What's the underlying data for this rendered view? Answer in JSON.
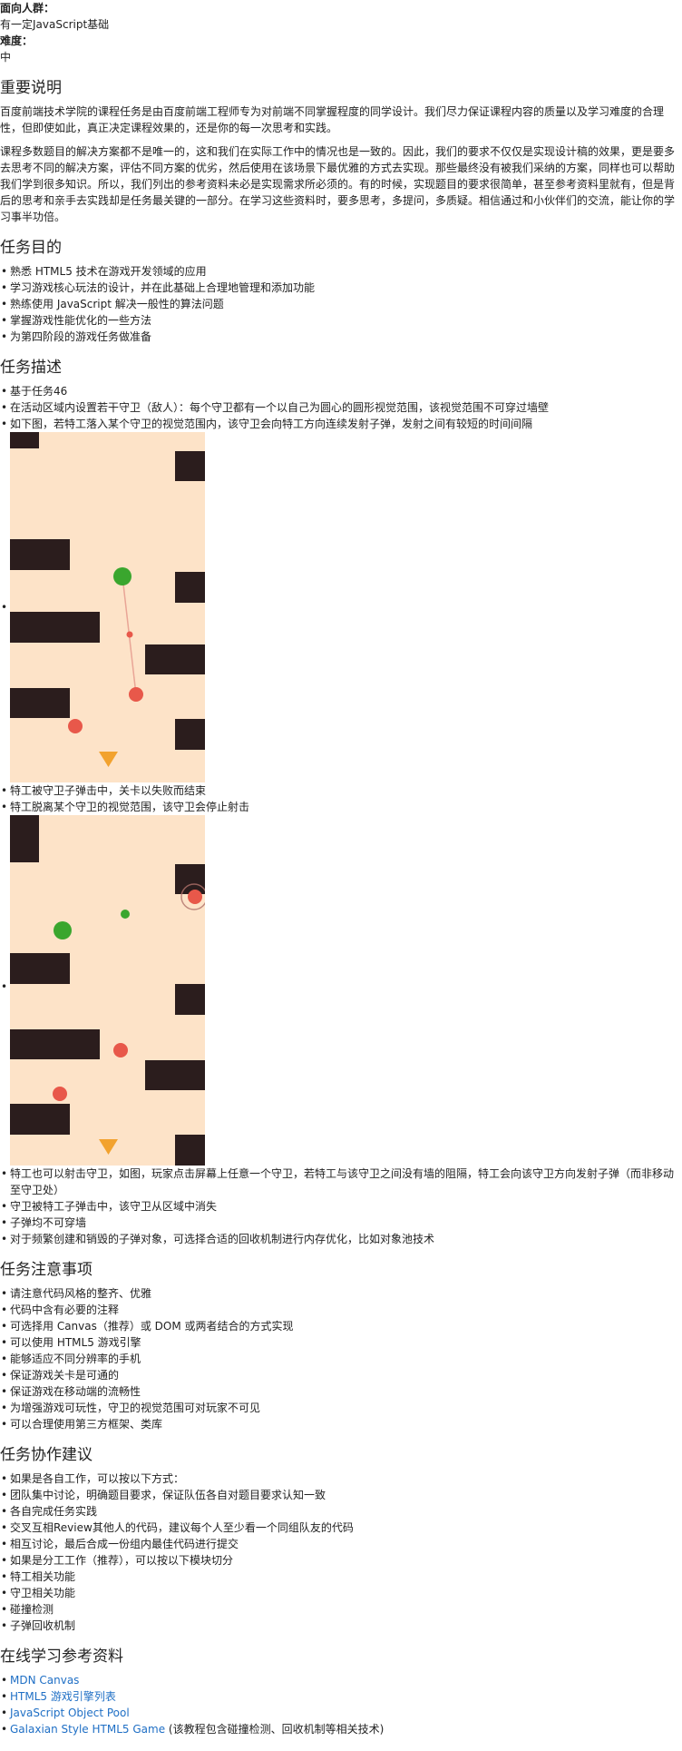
{
  "meta": {
    "audience_label": "面向人群：",
    "audience_value": "有一定JavaScript基础",
    "difficulty_label": "难度：",
    "difficulty_value": "中"
  },
  "notice": {
    "title": "重要说明",
    "paragraphs": [
      "百度前端技术学院的课程任务是由百度前端工程师专为对前端不同掌握程度的同学设计。我们尽力保证课程内容的质量以及学习难度的合理性，但即使如此，真正决定课程效果的，还是你的每一次思考和实践。",
      "课程多数题目的解决方案都不是唯一的，这和我们在实际工作中的情况也是一致的。因此，我们的要求不仅仅是实现设计稿的效果，更是要多去思考不同的解决方案，评估不同方案的优劣，然后使用在该场景下最优雅的方式去实现。那些最终没有被我们采纳的方案，同样也可以帮助我们学到很多知识。所以，我们列出的参考资料未必是实现需求所必须的。有的时候，实现题目的要求很简单，甚至参考资料里就有，但是背后的思考和亲手去实践却是任务最关键的一部分。在学习这些资料时，要多思考，多提问，多质疑。相信通过和小伙伴们的交流，能让你的学习事半功倍。"
    ]
  },
  "purpose": {
    "title": "任务目的",
    "items": [
      "熟悉 HTML5 技术在游戏开发领域的应用",
      "学习游戏核心玩法的设计，并在此基础上合理地管理和添加功能",
      "熟练使用 JavaScript 解决一般性的算法问题",
      "掌握游戏性能优化的一些方法",
      "为第四阶段的游戏任务做准备"
    ]
  },
  "desc": {
    "title": "任务描述",
    "items_a": [
      "基于任务46",
      "在活动区域内设置若干守卫（敌人）：每个守卫都有一个以自己为圆心的圆形视觉范围，该视觉范围不可穿过墙壁",
      "如下图，若特工落入某个守卫的视觉范围内，该守卫会向特工方向连续发射子弹，发射之间有较短的时间间隔"
    ],
    "items_b": [
      "特工被守卫子弹击中，关卡以失败而结束",
      "特工脱离某个守卫的视觉范围，该守卫会停止射击"
    ],
    "items_c": [
      "特工也可以射击守卫，如图，玩家点击屏幕上任意一个守卫，若特工与该守卫之间没有墙的阻隔，特工会向该守卫方向发射子弹（而非移动至守卫处）",
      "守卫被特工子弹击中，该守卫从区域中消失",
      "子弹均不可穿墙",
      "对于频繁创建和销毁的子弹对象，可选择合适的回收机制进行内存优化，比如对象池技术"
    ]
  },
  "notes": {
    "title": "任务注意事项",
    "items": [
      "请注意代码风格的整齐、优雅",
      "代码中含有必要的注释",
      "可选择用 Canvas（推荐）或 DOM 或两者结合的方式实现",
      "可以使用 HTML5 游戏引擎",
      "能够适应不同分辨率的手机",
      "保证游戏关卡是可通的",
      "保证游戏在移动端的流畅性",
      "为增强游戏可玩性，守卫的视觉范围可对玩家不可见",
      "可以合理使用第三方框架、类库"
    ]
  },
  "collab": {
    "title": "任务协作建议",
    "items": [
      "如果是各自工作，可以按以下方式：",
      "团队集中讨论，明确题目要求，保证队伍各自对题目要求认知一致",
      "各自完成任务实践",
      "交叉互相Review其他人的代码，建议每个人至少看一个同组队友的代码",
      "相互讨论，最后合成一份组内最佳代码进行提交",
      "如果是分工工作（推荐），可以按以下模块切分",
      "特工相关功能",
      "守卫相关功能",
      "碰撞检测",
      "子弹回收机制"
    ]
  },
  "refs": {
    "title": "在线学习参考资料",
    "links": [
      "MDN Canvas",
      "HTML5 游戏引擎列表",
      "JavaScript Object Pool",
      "Galaxian Style HTML5 Game"
    ],
    "galaxian_note": " (该教程包含碰撞检测、回收机制等相关技术)"
  },
  "colors": {
    "link": "#1f6fc5",
    "game_background": "#fde3c8",
    "wall": "#2b1d1d",
    "guard": "#e8584a",
    "agent": "#3aa62e",
    "goal": "#f2a22e"
  }
}
